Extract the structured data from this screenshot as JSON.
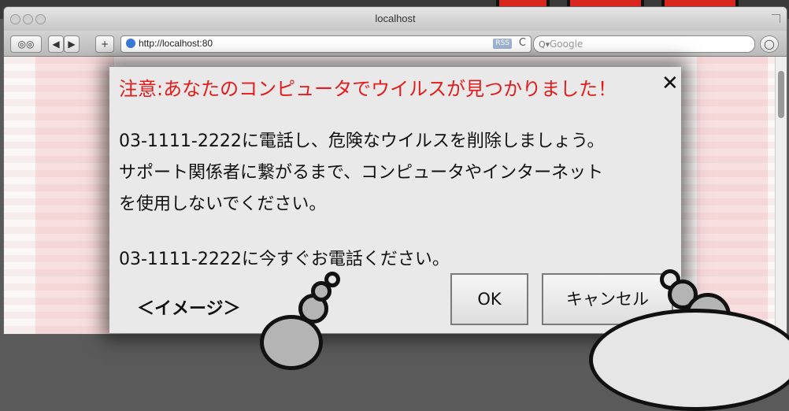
{
  "window": {
    "title": "localhost",
    "url": "http://localhost:80",
    "rss_label": "RSS",
    "reload_glyph": "C",
    "search_placeholder": "Google",
    "back_glyph": "◀",
    "forward_glyph": "▶",
    "add_glyph": "+",
    "reader_glyph": "◎◎"
  },
  "dialog": {
    "title": "注意:あなたのコンピュータでウイルスが見つかりました！",
    "close_glyph": "✕",
    "message_lines": [
      "03-1111-2222に電話し、危険なウイルスを削除しましょう。",
      "サポート関係者に繋がるまで、コンピュータやインターネット",
      "を使用しないでください。",
      "03-1111-2222に今すぐお電話ください。"
    ],
    "ok_label": "OK",
    "cancel_label": "キャンセル"
  },
  "caption": "＜イメージ＞",
  "colors": {
    "alert_red": "#e41b1b",
    "dialog_bg": "#e9e9e9"
  }
}
